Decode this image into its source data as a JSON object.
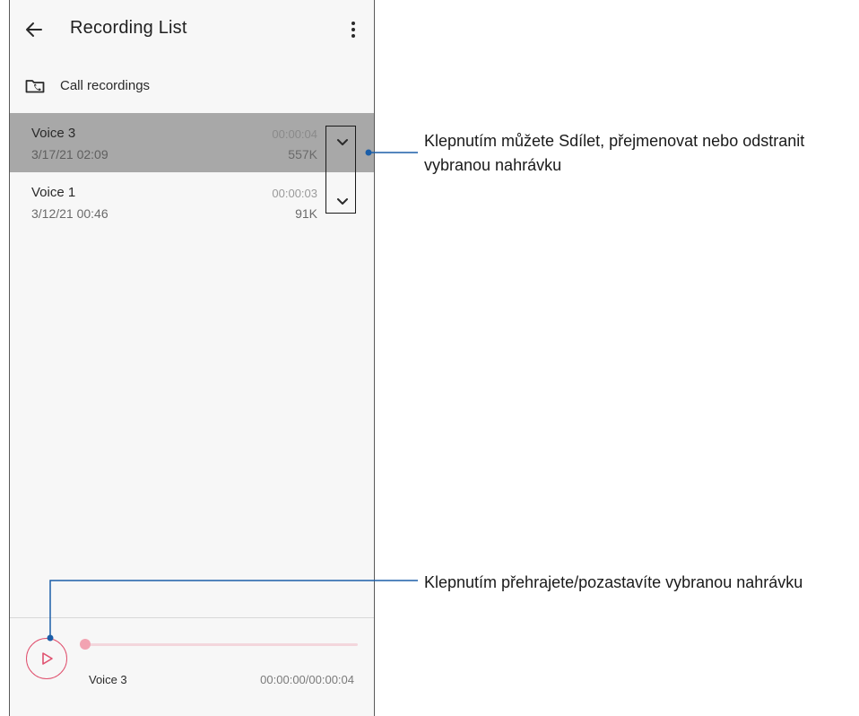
{
  "app": {
    "title": "Recording List"
  },
  "folder": {
    "label": "Call recordings"
  },
  "recordings": [
    {
      "name": "Voice 3",
      "date": "3/17/21 02:09",
      "duration": "00:00:04",
      "size": "557K",
      "selected": true
    },
    {
      "name": "Voice 1",
      "date": "3/12/21 00:46",
      "duration": "00:00:03",
      "size": "91K",
      "selected": false
    }
  ],
  "player": {
    "name": "Voice 3",
    "time": "00:00:00/00:00:04",
    "progress": 0.0
  },
  "callouts": {
    "expand": "Klepnutím můžete Sdílet, přejmenovat nebo odstranit vybranou nahrávku",
    "play": "Klepnutím přehrajete/pozastavíte vybranou nahrávku"
  },
  "colors": {
    "accent": "#e0506e",
    "selected_row": "#a8a8a8",
    "callout_line": "#1b5ea8"
  },
  "icons": {
    "back": "arrow-left-icon",
    "more": "more-vert-icon",
    "folder": "folder-call-icon",
    "expand": "chevron-down-icon",
    "play": "play-icon"
  }
}
